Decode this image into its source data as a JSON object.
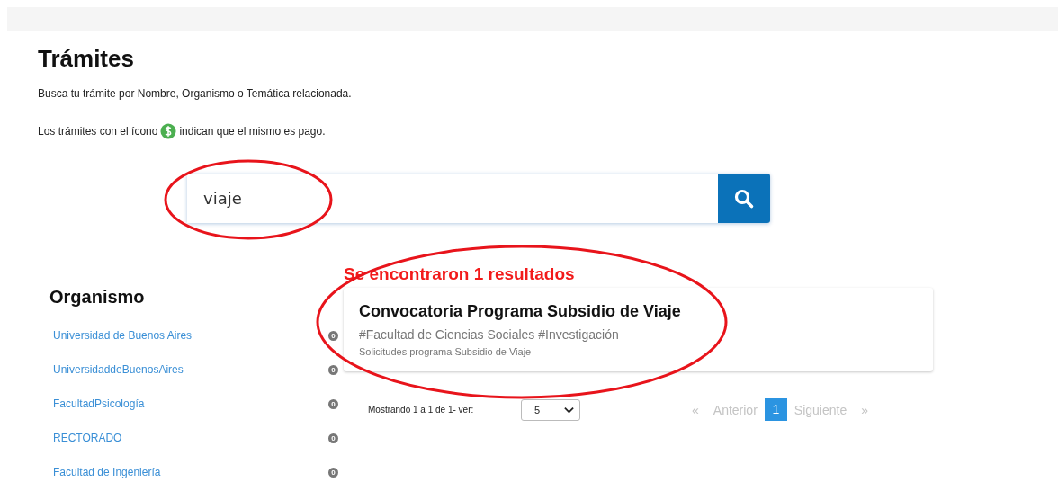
{
  "page": {
    "title": "Trámites",
    "intro": "Busca tu trámite por Nombre, Organismo o Temática relacionada.",
    "paid_note_before": "Los trámites con el ícono",
    "paid_note_after": "indican que el mismo es pago."
  },
  "search": {
    "value": "viaje",
    "highlighted": true
  },
  "sidebar": {
    "title": "Organismo",
    "items": [
      {
        "label": "Universidad de Buenos Aires",
        "count": "0"
      },
      {
        "label": "UniversidaddeBuenosAires",
        "count": "0"
      },
      {
        "label": "FacultadPsicología",
        "count": "0"
      },
      {
        "label": "RECTORADO",
        "count": "0"
      },
      {
        "label": "Facultad de Ingeniería",
        "count": "0"
      }
    ]
  },
  "results": {
    "summary": "Se encontraron 1 resultados",
    "highlighted": true,
    "items": [
      {
        "title": "Convocatoria Programa Subsidio de Viaje",
        "tags": "#Facultad de Ciencias Sociales #Investigación",
        "description": "Solicitudes programa Subsidio de Viaje"
      }
    ]
  },
  "pagination": {
    "showing": "Mostrando 1 a 1 de 1- ver:",
    "page_size": "5",
    "prev_mark": "«",
    "prev": "Anterior",
    "pages": [
      {
        "label": "1",
        "selected": true
      }
    ],
    "next": "Siguiente",
    "next_mark": "»",
    "prev_disabled": true,
    "next_disabled": true
  }
}
